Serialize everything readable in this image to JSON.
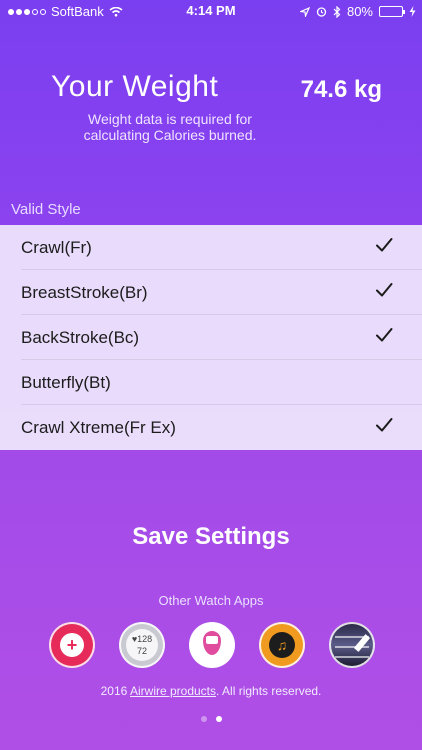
{
  "status_bar": {
    "carrier": "SoftBank",
    "time": "4:14 PM",
    "battery_percent": "80%",
    "battery_level": 0.8,
    "battery_color": "#4cd964",
    "icons": [
      "signal-dots-icon",
      "wifi-icon",
      "location-icon",
      "alarm-icon",
      "bluetooth-icon",
      "battery-icon",
      "charging-icon"
    ]
  },
  "header": {
    "title": "Your Weight",
    "value": "74.6 kg",
    "note": "Weight data is required for calculating Calories burned."
  },
  "section_label": "Valid Style",
  "styles": [
    {
      "label": "Crawl(Fr)",
      "checked": true
    },
    {
      "label": "BreastStroke(Br)",
      "checked": true
    },
    {
      "label": "BackStroke(Bc)",
      "checked": true
    },
    {
      "label": "Butterfly(Bt)",
      "checked": false
    },
    {
      "label": "Crawl Xtreme(Fr Ex)",
      "checked": true
    }
  ],
  "save_label": "Save Settings",
  "other_apps_label": "Other Watch Apps",
  "apps": [
    {
      "icon": "scale-app-icon",
      "text": "+"
    },
    {
      "icon": "heart-rate-app-icon",
      "text": "♥128\n72"
    },
    {
      "icon": "location-pin-app-icon",
      "text": ""
    },
    {
      "icon": "music-app-icon",
      "text": "♫"
    },
    {
      "icon": "drawing-app-icon",
      "text": ""
    }
  ],
  "footer": {
    "year": "2016",
    "link": "Airwire products",
    "suffix": ". All rights reserved."
  },
  "pager": {
    "count": 2,
    "active_index": 1
  },
  "colors": {
    "background_top": "#7a3ff0",
    "background_bottom": "#b04fe6",
    "list_background": "#f0e8fc",
    "check": "#1c1c1c"
  }
}
